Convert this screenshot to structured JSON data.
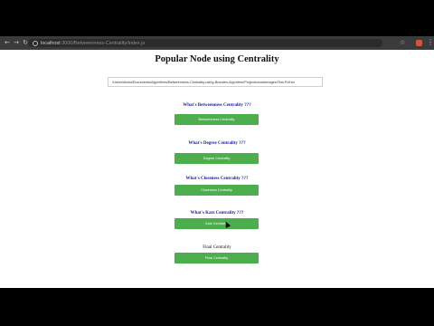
{
  "browser": {
    "back_icon": "arrow-left",
    "forward_icon": "arrow-right",
    "reload_icon": "reload",
    "url_host": "localhost",
    "url_rest": ":3000/Betweenness-Centrality/index.js",
    "star_icon": "star",
    "menu_icon": "more-vert"
  },
  "page": {
    "title": "Popular Node using Centrality",
    "path_value": "/Users/Abdul/Documents/Algorithms/Betweenness-Centrality-using-Brandes-Algorithm/Projects/nodeimages/Test-Pdf.txt",
    "sections": [
      {
        "question": "What's Betweenness Centrality ???",
        "button": "Betweenness Centrality"
      },
      {
        "question": "What's Degree Centrality ???",
        "button": "Degree Centrality"
      },
      {
        "question": "What's Closeness Centrality ???",
        "button": "Closeness Centrality"
      },
      {
        "question": "What's Katz Centrality ???",
        "button": "Katz Centrality"
      },
      {
        "question": "Final Centrality",
        "button": "Final Centrality"
      }
    ]
  },
  "colors": {
    "button_green": "#4cae4c",
    "question_blue": "#1a1a9e"
  }
}
